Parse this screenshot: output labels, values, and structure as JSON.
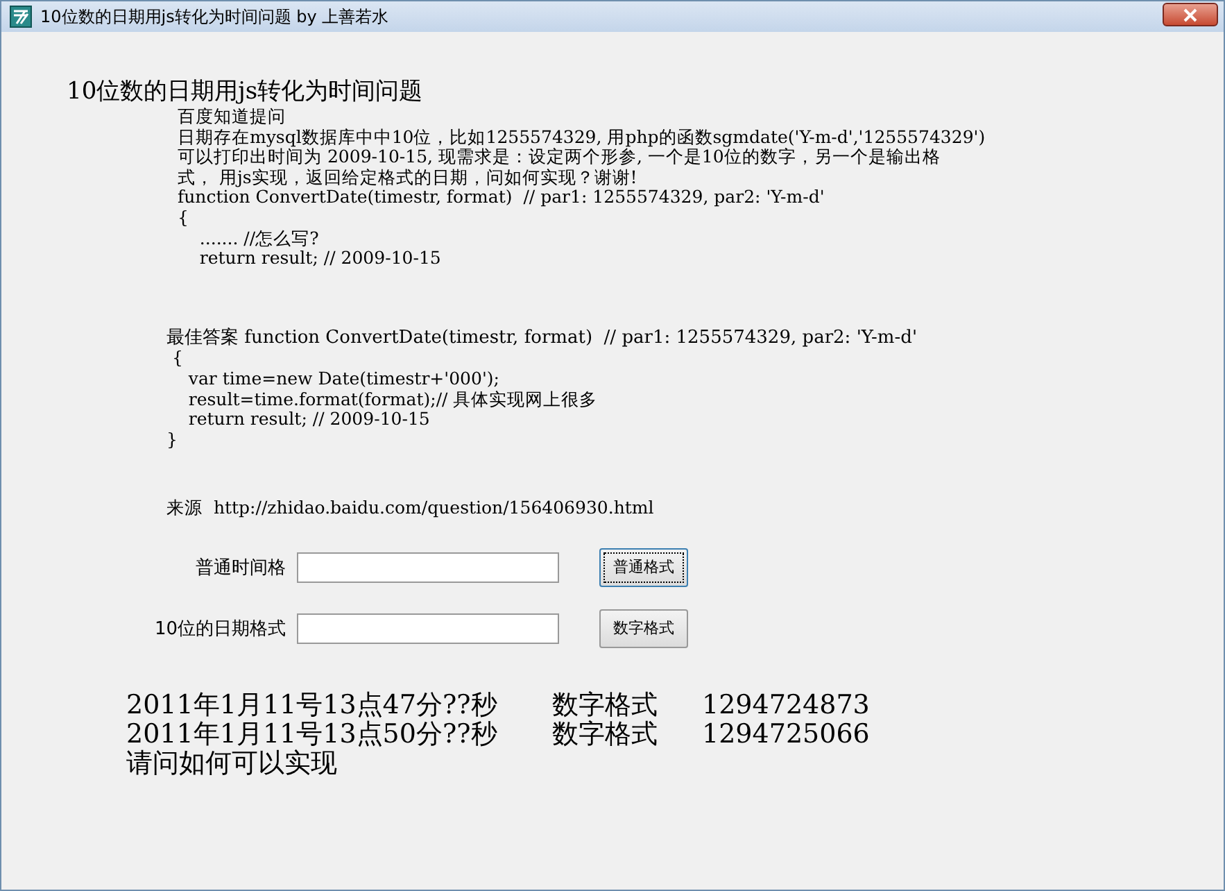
{
  "window": {
    "title": "10位数的日期用js转化为时间问题 by 上善若水"
  },
  "heading": "10位数的日期用js转化为时间问题",
  "question": {
    "lines": [
      "百度知道提问",
      "日期存在mysql数据库中中10位，比如1255574329, 用php的函数sgmdate('Y-m-d','1255574329')",
      "可以打印出时间为 2009-10-15, 现需求是：设定两个形参, 一个是10位的数字，另一个是输出格",
      "式， 用js实现，返回给定格式的日期，问如何实现？谢谢!",
      "function ConvertDate(timestr, format)  // par1: 1255574329, par2: 'Y-m-d'",
      "{",
      "    ....... //怎么写?",
      "    return result; // 2009-10-15"
    ]
  },
  "answer": {
    "lines": [
      "最佳答案 function ConvertDate(timestr, format)  // par1: 1255574329, par2: 'Y-m-d'",
      " {",
      "    var time=new Date(timestr+'000');",
      "    result=time.format(format);// 具体实现网上很多",
      "    return result; // 2009-10-15",
      "}"
    ]
  },
  "source": "来源  http://zhidao.baidu.com/question/156406930.html",
  "form": [
    {
      "label": "普通时间格",
      "button": "普通格式",
      "focused": true
    },
    {
      "label": "10位的日期格式",
      "button": "数字格式",
      "focused": false
    }
  ],
  "results": [
    {
      "date": "2011年1月11号13点47分??秒",
      "kind_label": "数字格式",
      "number": "1294724873"
    },
    {
      "date": "2011年1月11号13点50分??秒",
      "kind_label": "数字格式",
      "number": "1294725066"
    }
  ],
  "footer": "请问如何可以实现"
}
